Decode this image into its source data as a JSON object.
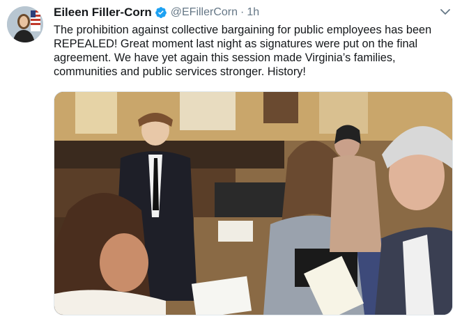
{
  "tweet": {
    "display_name": "Eileen Filler-Corn",
    "handle": "@EFillerCorn",
    "separator": "·",
    "time": "1h",
    "text_lines": [
      "The prohibition against collective  bargaining for public employees has been",
      "REPEALED!  Great moment last night as signatures were put on the final",
      "agreement. We have yet again this session made Virginia’s families,",
      "communities and public services stronger. History!"
    ],
    "verified": true
  },
  "icons": {
    "verified": "verified-badge-icon",
    "menu": "chevron-down-icon"
  },
  "colors": {
    "name": "#14171a",
    "meta": "#657786",
    "verified": "#1da1f2",
    "border": "#e1e8ed"
  }
}
